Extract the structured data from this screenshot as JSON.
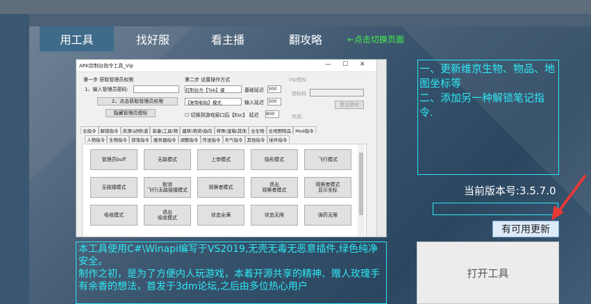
{
  "tabs": [
    {
      "label": "用工具",
      "active": true
    },
    {
      "label": "找好服",
      "active": false
    },
    {
      "label": "看主播",
      "active": false
    },
    {
      "label": "翻攻略",
      "active": false
    }
  ],
  "hint": "←点击切换页面",
  "news": "一、更新维京生物、物品、地图坐标等\n二、添加另一种解锁笔记指令.",
  "version_text": "当前版本号:3.5.7.0",
  "progress": 0,
  "update_button": "有可用更新",
  "open_button": "打开工具",
  "description": "本工具使用C#\\Winapi编写于VS2019,无壳无毒无恶意插件,绿色纯净安全。\n制作之初，是为了方便内人玩游戏，本着开源共享的精神、赠人玫瑰手有余香的想法，首发于3dm论坛,之后由多位热心用户",
  "colors": {
    "accent": "#2fe8f5",
    "hint": "#45f04a",
    "active_tab": "#3f6b8a",
    "arrow": "#e53935"
  },
  "embedded": {
    "title": "ARK控制台指令工具_Vip",
    "step1": "第一步 获取管理员权限",
    "step1_item": "1、输入管理员密码:",
    "step1_btn": "2、点击获取管理员权限",
    "step1_btn2": "隐藏管理员图标",
    "step2": "第二步 设置操作方式",
    "s2_console": "控制台为【Tab】键",
    "s2_basic_delay": "基础延迟",
    "s2_basic_delay_val": "300",
    "s2_paste": "【复制粘贴】模式",
    "s2_input_delay": "输入延迟",
    "s2_input_delay_val": "300",
    "s2_switch": "切换到游戏窗口后【Esc】",
    "s2_delay": "延迟",
    "s2_delay_val": "800",
    "vip": "Vip授权",
    "vip_code": "授权码",
    "vip_btn": "激活授权",
    "vip_status": "状态:",
    "tabs1": [
      "全指令",
      "解锁指令",
      "资源\\动物\\道",
      "装备\\工具\\物",
      "建筑\\物资\\指向",
      "特殊\\宝箱\\其他",
      "全生物",
      "全地图物品",
      "Mod指令"
    ],
    "tabs2": [
      "人物指令",
      "生物指令",
      "部落指令",
      "服务器指令",
      "调整指令",
      "传送指令",
      "天气指令",
      "其他指令",
      "插件指令"
    ],
    "buttons": [
      [
        "管理员buff",
        "无敌模式",
        "上帝模式",
        "隐形模式",
        "飞行模式"
      ],
      [
        "无碰撞模式",
        "取消\n飞行\\无敌碰撞模式",
        "观察者模式",
        "退出\n观察者模式",
        "观察者模式\n显示坐标"
      ],
      [
        "吸收模式",
        "退出\n吸收模式",
        "状态全满",
        "状态无限",
        "弹药无限"
      ]
    ]
  }
}
